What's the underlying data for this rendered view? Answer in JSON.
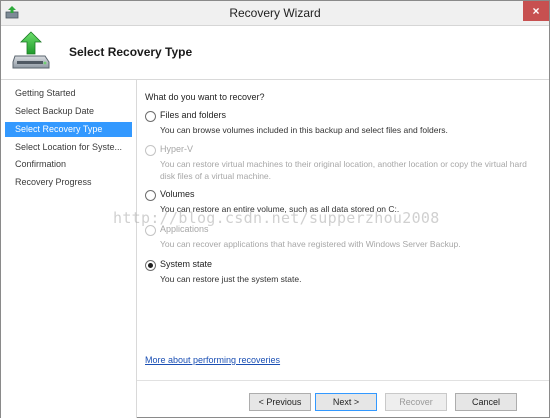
{
  "window": {
    "title": "Recovery Wizard",
    "close_glyph": "×",
    "page_title": "Select Recovery Type"
  },
  "nav": {
    "items": [
      {
        "label": "Getting Started",
        "active": false
      },
      {
        "label": "Select Backup Date",
        "active": false
      },
      {
        "label": "Select Recovery Type",
        "active": true
      },
      {
        "label": "Select Location for Syste...",
        "active": false
      },
      {
        "label": "Confirmation",
        "active": false
      },
      {
        "label": "Recovery Progress",
        "active": false
      }
    ]
  },
  "content": {
    "question": "What do you want to recover?",
    "options": [
      {
        "label": "Files and folders",
        "description": "You can browse volumes included in this backup and select files and folders.",
        "enabled": true,
        "selected": false
      },
      {
        "label": "Hyper-V",
        "description": "You can restore virtual machines to their original location, another location or copy the virtual hard disk files of a virtual machine.",
        "enabled": false,
        "selected": false
      },
      {
        "label": "Volumes",
        "description": "You can restore an entire volume, such as all data stored on C:.",
        "enabled": true,
        "selected": false
      },
      {
        "label": "Applications",
        "description": "You can recover applications that have registered with Windows Server Backup.",
        "enabled": false,
        "selected": false
      },
      {
        "label": "System state",
        "description": "You can restore just the system state.",
        "enabled": true,
        "selected": true
      }
    ],
    "more_link": "More about performing recoveries"
  },
  "buttons": {
    "previous": "< Previous",
    "next": "Next >",
    "recover": "Recover",
    "cancel": "Cancel"
  },
  "watermark": "http://blog.csdn.net/supperzhou2008",
  "colors": {
    "selection": "#3399ff",
    "close_button": "#c75050",
    "link": "#1a4fb4"
  }
}
